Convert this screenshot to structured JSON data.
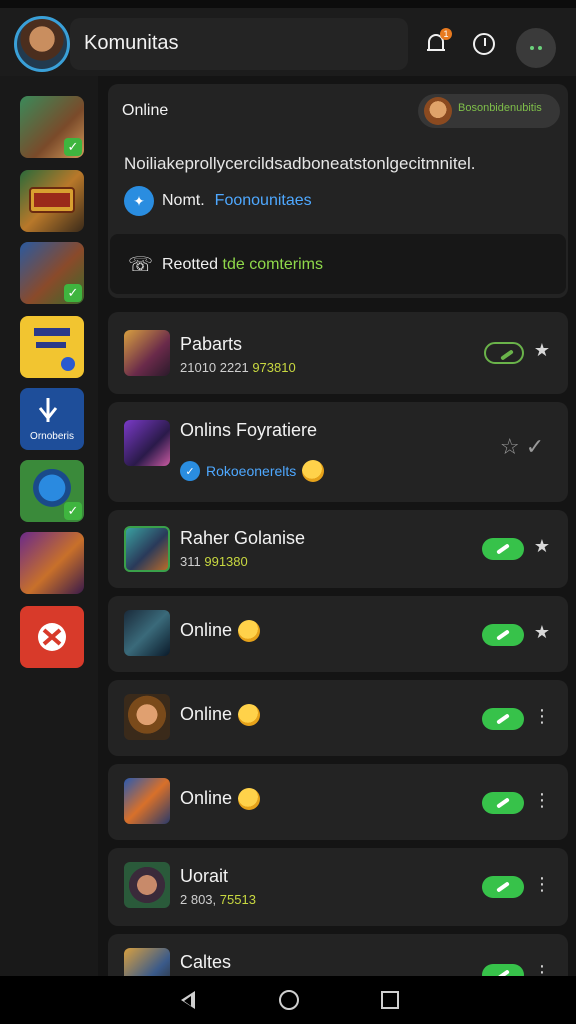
{
  "header": {
    "title": "Komunitas",
    "notification_badge": "1"
  },
  "rail": {
    "items": [
      {
        "name": "warrior-hero",
        "label": "",
        "checked": true
      },
      {
        "name": "tournament-banner",
        "label": "",
        "checked": false
      },
      {
        "name": "brawler-hero",
        "label": "",
        "checked": true
      },
      {
        "name": "yellow-card",
        "label": "",
        "checked": false
      },
      {
        "name": "blue-logo",
        "label": "Ornoberis",
        "checked": false
      },
      {
        "name": "blue-creature",
        "label": "",
        "checked": true
      },
      {
        "name": "purple-knight",
        "label": "",
        "checked": false
      },
      {
        "name": "red-emblem",
        "label": "",
        "checked": false
      }
    ]
  },
  "online_section": {
    "title": "Online",
    "chip_label": "Bosonbidenubitis",
    "description": "Noiliakeprollycercildsadboneatstonlgecitmnitel.",
    "link_primary": "Nomt.",
    "link_secondary": "Foonounitaes",
    "report_text_a": "Reotted",
    "report_text_b": "tde comterims"
  },
  "list": [
    {
      "name": "Pabarts",
      "meta_a": "21010 2221",
      "meta_b": "973810",
      "emoji": false,
      "toggle": "outline",
      "side": "★"
    },
    {
      "name": "Onlins Foyratiere",
      "meta_a": "",
      "meta_b": "",
      "badge_text": "Rokoeonerelts",
      "emoji": true,
      "toggle": "none",
      "side": "☆ ✓"
    },
    {
      "name": "Raher Golanise",
      "meta_a": "311",
      "meta_b": "991380",
      "emoji": false,
      "toggle": "on",
      "side": "★"
    },
    {
      "name": "Online",
      "meta_a": "",
      "meta_b": "",
      "emoji": true,
      "toggle": "on",
      "side": "★"
    },
    {
      "name": "Online",
      "meta_a": "",
      "meta_b": "",
      "emoji": true,
      "toggle": "on",
      "side": "⋮"
    },
    {
      "name": "Online",
      "meta_a": "",
      "meta_b": "",
      "emoji": true,
      "toggle": "on",
      "side": "⋮"
    },
    {
      "name": "Uorait",
      "meta_a": "2 803,",
      "meta_b": "75513",
      "emoji": false,
      "toggle": "on",
      "side": "⋮"
    },
    {
      "name": "Caltes",
      "meta_a": "",
      "meta_b": "",
      "emoji": false,
      "toggle": "on",
      "side": "⋮"
    }
  ],
  "colors": {
    "accent_green": "#37c24a",
    "link_blue": "#4ea8ff",
    "background": "#141414"
  }
}
